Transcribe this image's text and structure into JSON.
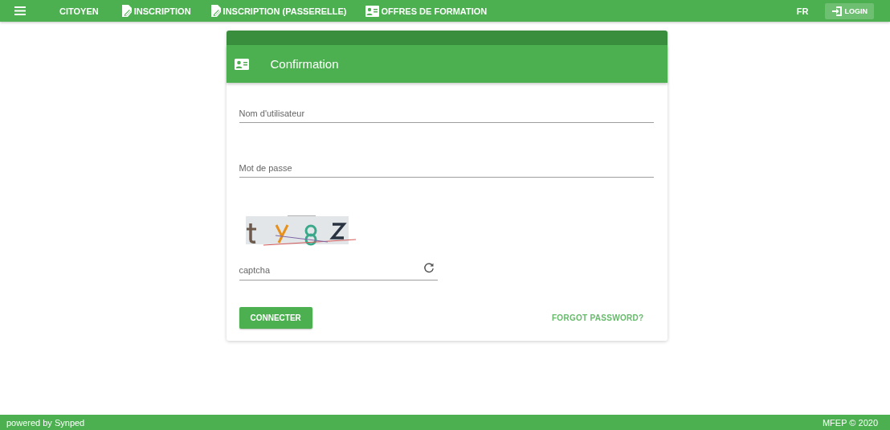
{
  "navbar": {
    "items": [
      {
        "label": "CITOYEN",
        "kind": "text"
      },
      {
        "label": "INSCRIPTION",
        "kind": "document"
      },
      {
        "label": "INSCRIPTION (PASSERELLE)",
        "kind": "document"
      },
      {
        "label": "OFFRES DE FORMATION",
        "kind": "card"
      }
    ],
    "language": "FR",
    "login": "LOGIN"
  },
  "card": {
    "title": "Confirmation",
    "fields": [
      {
        "placeholder": "Nom d'utilisateur"
      },
      {
        "placeholder": "Mot de passe"
      }
    ],
    "captcha": {
      "kind": "picture",
      "placeholder": "captcha"
    },
    "submit": "CONNECTER",
    "forgot": "FORGOT PASSWORD?"
  },
  "footer": {
    "left": "powered by Synped",
    "right": "MFEP © 2020"
  }
}
